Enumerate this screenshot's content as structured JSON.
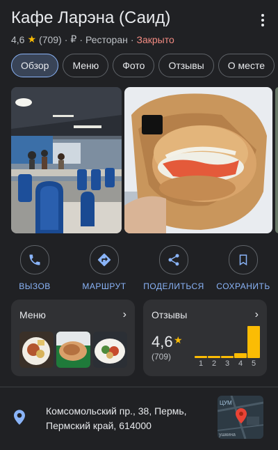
{
  "header": {
    "title": "Кафе Ларэна (Саид)",
    "rating": "4,6",
    "reviews_count": "(709)",
    "price": "₽",
    "separator": "·",
    "category": "Ресторан",
    "status": "Закрыто"
  },
  "tabs": [
    {
      "label": "Обзор",
      "active": true
    },
    {
      "label": "Меню"
    },
    {
      "label": "Фото"
    },
    {
      "label": "Отзывы"
    },
    {
      "label": "О месте"
    }
  ],
  "actions": [
    {
      "label": "ВЫЗОВ",
      "icon": "phone-icon"
    },
    {
      "label": "МАРШРУТ",
      "icon": "directions-icon"
    },
    {
      "label": "ПОДЕЛИТЬСЯ",
      "icon": "share-icon"
    },
    {
      "label": "СОХРАНИТЬ",
      "icon": "bookmark-icon"
    }
  ],
  "menu_card": {
    "title": "Меню"
  },
  "reviews_card": {
    "title": "Отзывы",
    "rating": "4,6",
    "count": "(709)",
    "distribution": [
      {
        "stars": "1",
        "fraction": 0.03
      },
      {
        "stars": "2",
        "fraction": 0.02
      },
      {
        "stars": "3",
        "fraction": 0.05
      },
      {
        "stars": "4",
        "fraction": 0.15
      },
      {
        "stars": "5",
        "fraction": 1.0
      }
    ]
  },
  "address": {
    "line1": "Комсомольский пр., 38, Пермь,",
    "line2": "Пермский край, 614000",
    "map_label_top": "ЦУМ",
    "map_label_bottom": "ушкина"
  },
  "colors": {
    "background": "#202124",
    "card": "#303134",
    "accent_blue": "#8ab4f8",
    "star": "#fbbc04",
    "closed": "#f28b82",
    "map_pin": "#ea4335"
  }
}
